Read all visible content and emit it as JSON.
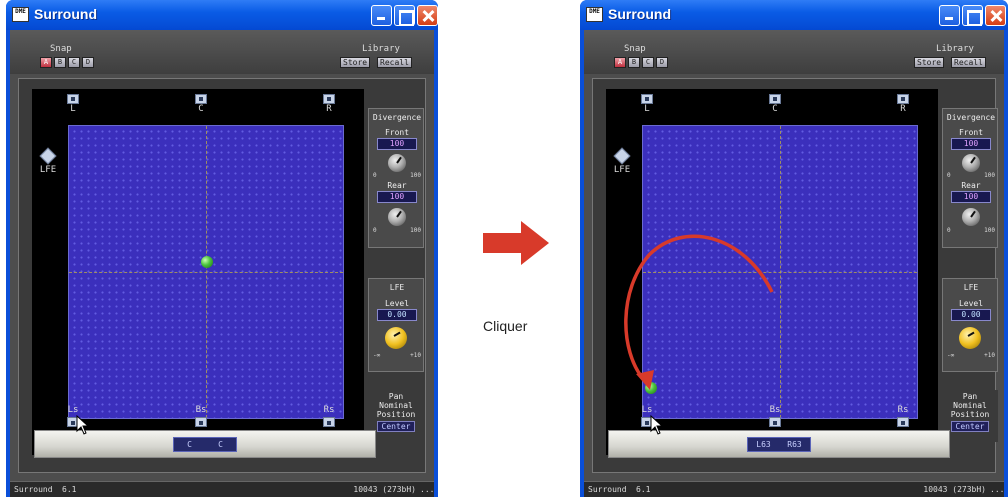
{
  "window": {
    "title": "Surround",
    "app_icon_text": "DME"
  },
  "snap": {
    "label": "Snap",
    "buttons": [
      "A",
      "B",
      "C",
      "D"
    ],
    "active": "A"
  },
  "library": {
    "label": "Library",
    "store": "Store",
    "recall": "Recall"
  },
  "speakers": {
    "L": "L",
    "C": "C",
    "R": "R",
    "Ls": "Ls",
    "Bs": "Bs",
    "Rs": "Rs",
    "LFE": "LFE"
  },
  "divergence": {
    "title": "Divergence",
    "front_label": "Front",
    "front_value": "100",
    "rear_label": "Rear",
    "rear_value": "100",
    "scale_min": "0",
    "scale_max": "100"
  },
  "lfe": {
    "title": "LFE",
    "level_label": "Level",
    "level_value": "0.00",
    "scale_min": "-∞",
    "scale_max": "+10"
  },
  "pan": {
    "line1": "Pan",
    "line2": "Nominal",
    "line3": "Position",
    "mode": "Center"
  },
  "before": {
    "position_left": "C",
    "position_right": "C"
  },
  "after": {
    "position_left": "L63",
    "position_right": "R63"
  },
  "status": {
    "name": "Surround",
    "version": "6.1",
    "id": "10043 (273bH)",
    "more": "..."
  },
  "annotation": {
    "action": "Cliquer",
    "arrow_color": "#d83a2a"
  }
}
